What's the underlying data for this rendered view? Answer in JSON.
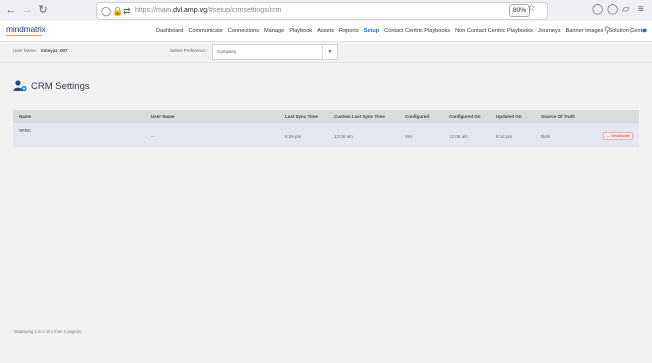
{
  "browser": {
    "url_prefix": "https://main.",
    "url_host": "dvl.amp.vg",
    "url_path": "/#setup/crmsettings/crm",
    "zoom": "80%"
  },
  "header": {
    "logo": "mindmatrix",
    "menu": [
      "Dashboard",
      "Communicate",
      "Connections",
      "Manage",
      "Playbook",
      "Assets",
      "Reports",
      "Setup",
      "Contact Centric Playbooks",
      "Non Contact Centric Playbooks",
      "Journeys",
      "Banner Images",
      "Solution Center"
    ],
    "active_menu": "Setup"
  },
  "prefs": {
    "user_name_label": "User Name:",
    "user_name_value": "Imteyaz_007",
    "select_pref_label": "Select Preference :",
    "select_pref_value": "Company"
  },
  "page": {
    "title": "CRM Settings"
  },
  "table": {
    "columns": [
      "Name",
      "User Name",
      "Last Sync Time",
      "Custom Last Sync Time",
      "Configured",
      "Configured On",
      "Updated On",
      "Source Of Truth"
    ],
    "rows": [
      {
        "name": "SFDC",
        "user_name": "--",
        "last_sync": "6:59 pm",
        "custom_last_sync": "12:06 am",
        "configured": "Yes",
        "configured_on": "12:06 am",
        "updated_on": "9:14 pm",
        "source": "Both",
        "action": "Deactivate"
      }
    ]
  },
  "footer": {
    "pagination_text": "Displaying 1 to 1 of 1 from 1 page(s)"
  },
  "colors": {
    "accent": "#1f6fc3",
    "logo": "#2a3a7a",
    "danger": "#c0392b"
  }
}
